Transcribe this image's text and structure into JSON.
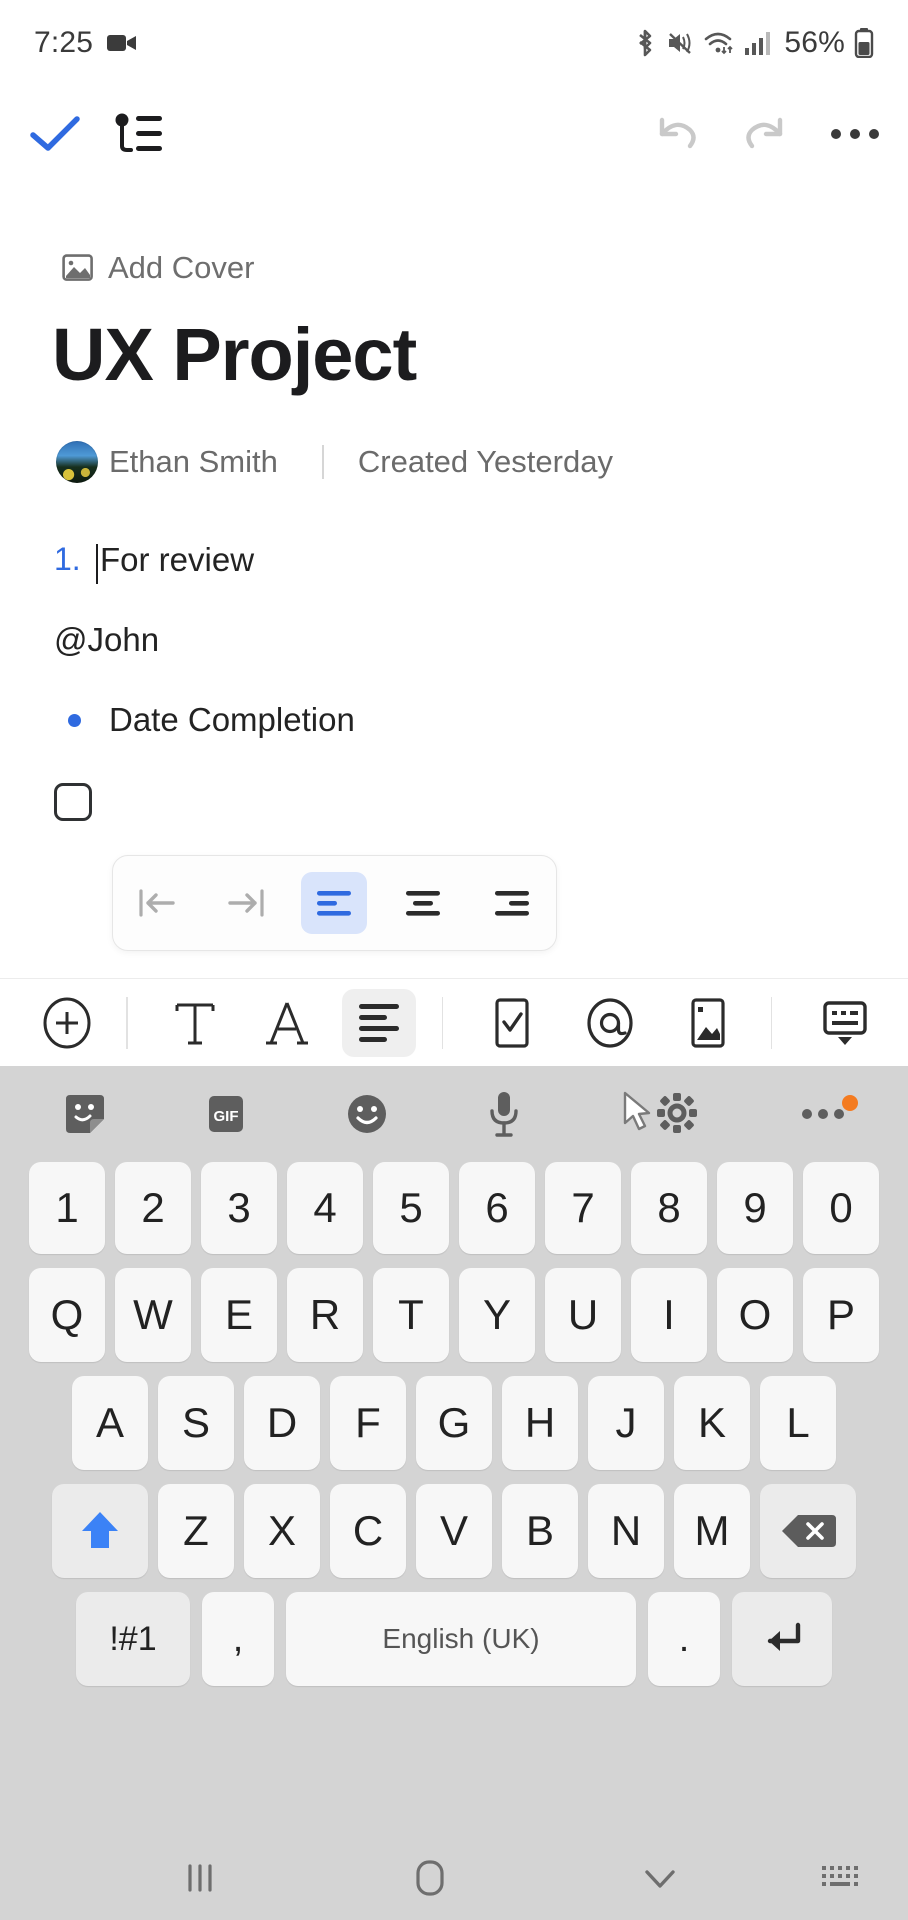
{
  "status_bar": {
    "time": "7:25",
    "battery_percent": "56%",
    "icons": [
      "video-recording-icon",
      "bluetooth-icon",
      "mute-vibrate-icon",
      "wifi-icon",
      "cellular-signal-icon",
      "battery-icon"
    ]
  },
  "app_bar": {
    "done_label": "done-check",
    "outline_label": "outline",
    "undo_label": "undo",
    "redo_label": "redo",
    "more_label": "more options"
  },
  "document": {
    "add_cover_label": "Add Cover",
    "title": "UX Project",
    "author": "Ethan Smith",
    "created": "Created Yesterday",
    "blocks": [
      {
        "type": "ordered",
        "marker": "1.",
        "text": "For review"
      },
      {
        "type": "paragraph",
        "text": "@John"
      },
      {
        "type": "bullet",
        "text": "Date Completion"
      },
      {
        "type": "checkbox",
        "text": "",
        "checked": false
      }
    ]
  },
  "align_popup": {
    "buttons": [
      {
        "name": "outdent",
        "active": false
      },
      {
        "name": "indent",
        "active": false
      },
      {
        "name": "align-left",
        "active": true
      },
      {
        "name": "align-center",
        "active": false
      },
      {
        "name": "align-right",
        "active": false
      }
    ]
  },
  "format_toolbar": {
    "items": [
      {
        "name": "add",
        "active": false
      },
      {
        "name": "text-style",
        "active": false
      },
      {
        "name": "font",
        "active": false
      },
      {
        "name": "paragraph-align",
        "active": true
      },
      {
        "name": "checklist",
        "active": false
      },
      {
        "name": "mention",
        "active": false
      },
      {
        "name": "image",
        "active": false
      },
      {
        "name": "hide-keyboard",
        "active": false
      }
    ]
  },
  "keyboard": {
    "toolbar": [
      "sticker",
      "gif",
      "emoji",
      "microphone",
      "settings",
      "more"
    ],
    "gif_label": "GIF",
    "rows": {
      "numbers": [
        "1",
        "2",
        "3",
        "4",
        "5",
        "6",
        "7",
        "8",
        "9",
        "0"
      ],
      "top": [
        "Q",
        "W",
        "E",
        "R",
        "T",
        "Y",
        "U",
        "I",
        "O",
        "P"
      ],
      "home": [
        "A",
        "S",
        "D",
        "F",
        "G",
        "H",
        "J",
        "K",
        "L"
      ],
      "bottom": [
        "Z",
        "X",
        "C",
        "V",
        "B",
        "N",
        "M"
      ]
    },
    "symbol_key": "!#1",
    "comma_key": ",",
    "space_key": "English (UK)",
    "period_key": ".",
    "shift_key": "shift",
    "backspace_key": "backspace",
    "enter_key": "enter"
  },
  "nav_bar": {
    "recents": "recents",
    "home": "home",
    "hide_keyboard": "hide-keyboard",
    "keyboard_switch": "switch-keyboard"
  },
  "colors": {
    "accent_blue": "#2f6ae0",
    "check_blue": "#2f6ae0",
    "active_bg": "#d9e4fb",
    "keyboard_bg": "#d4d4d4",
    "key_bg": "#f7f7f7",
    "orange_badge": "#f47b20"
  }
}
